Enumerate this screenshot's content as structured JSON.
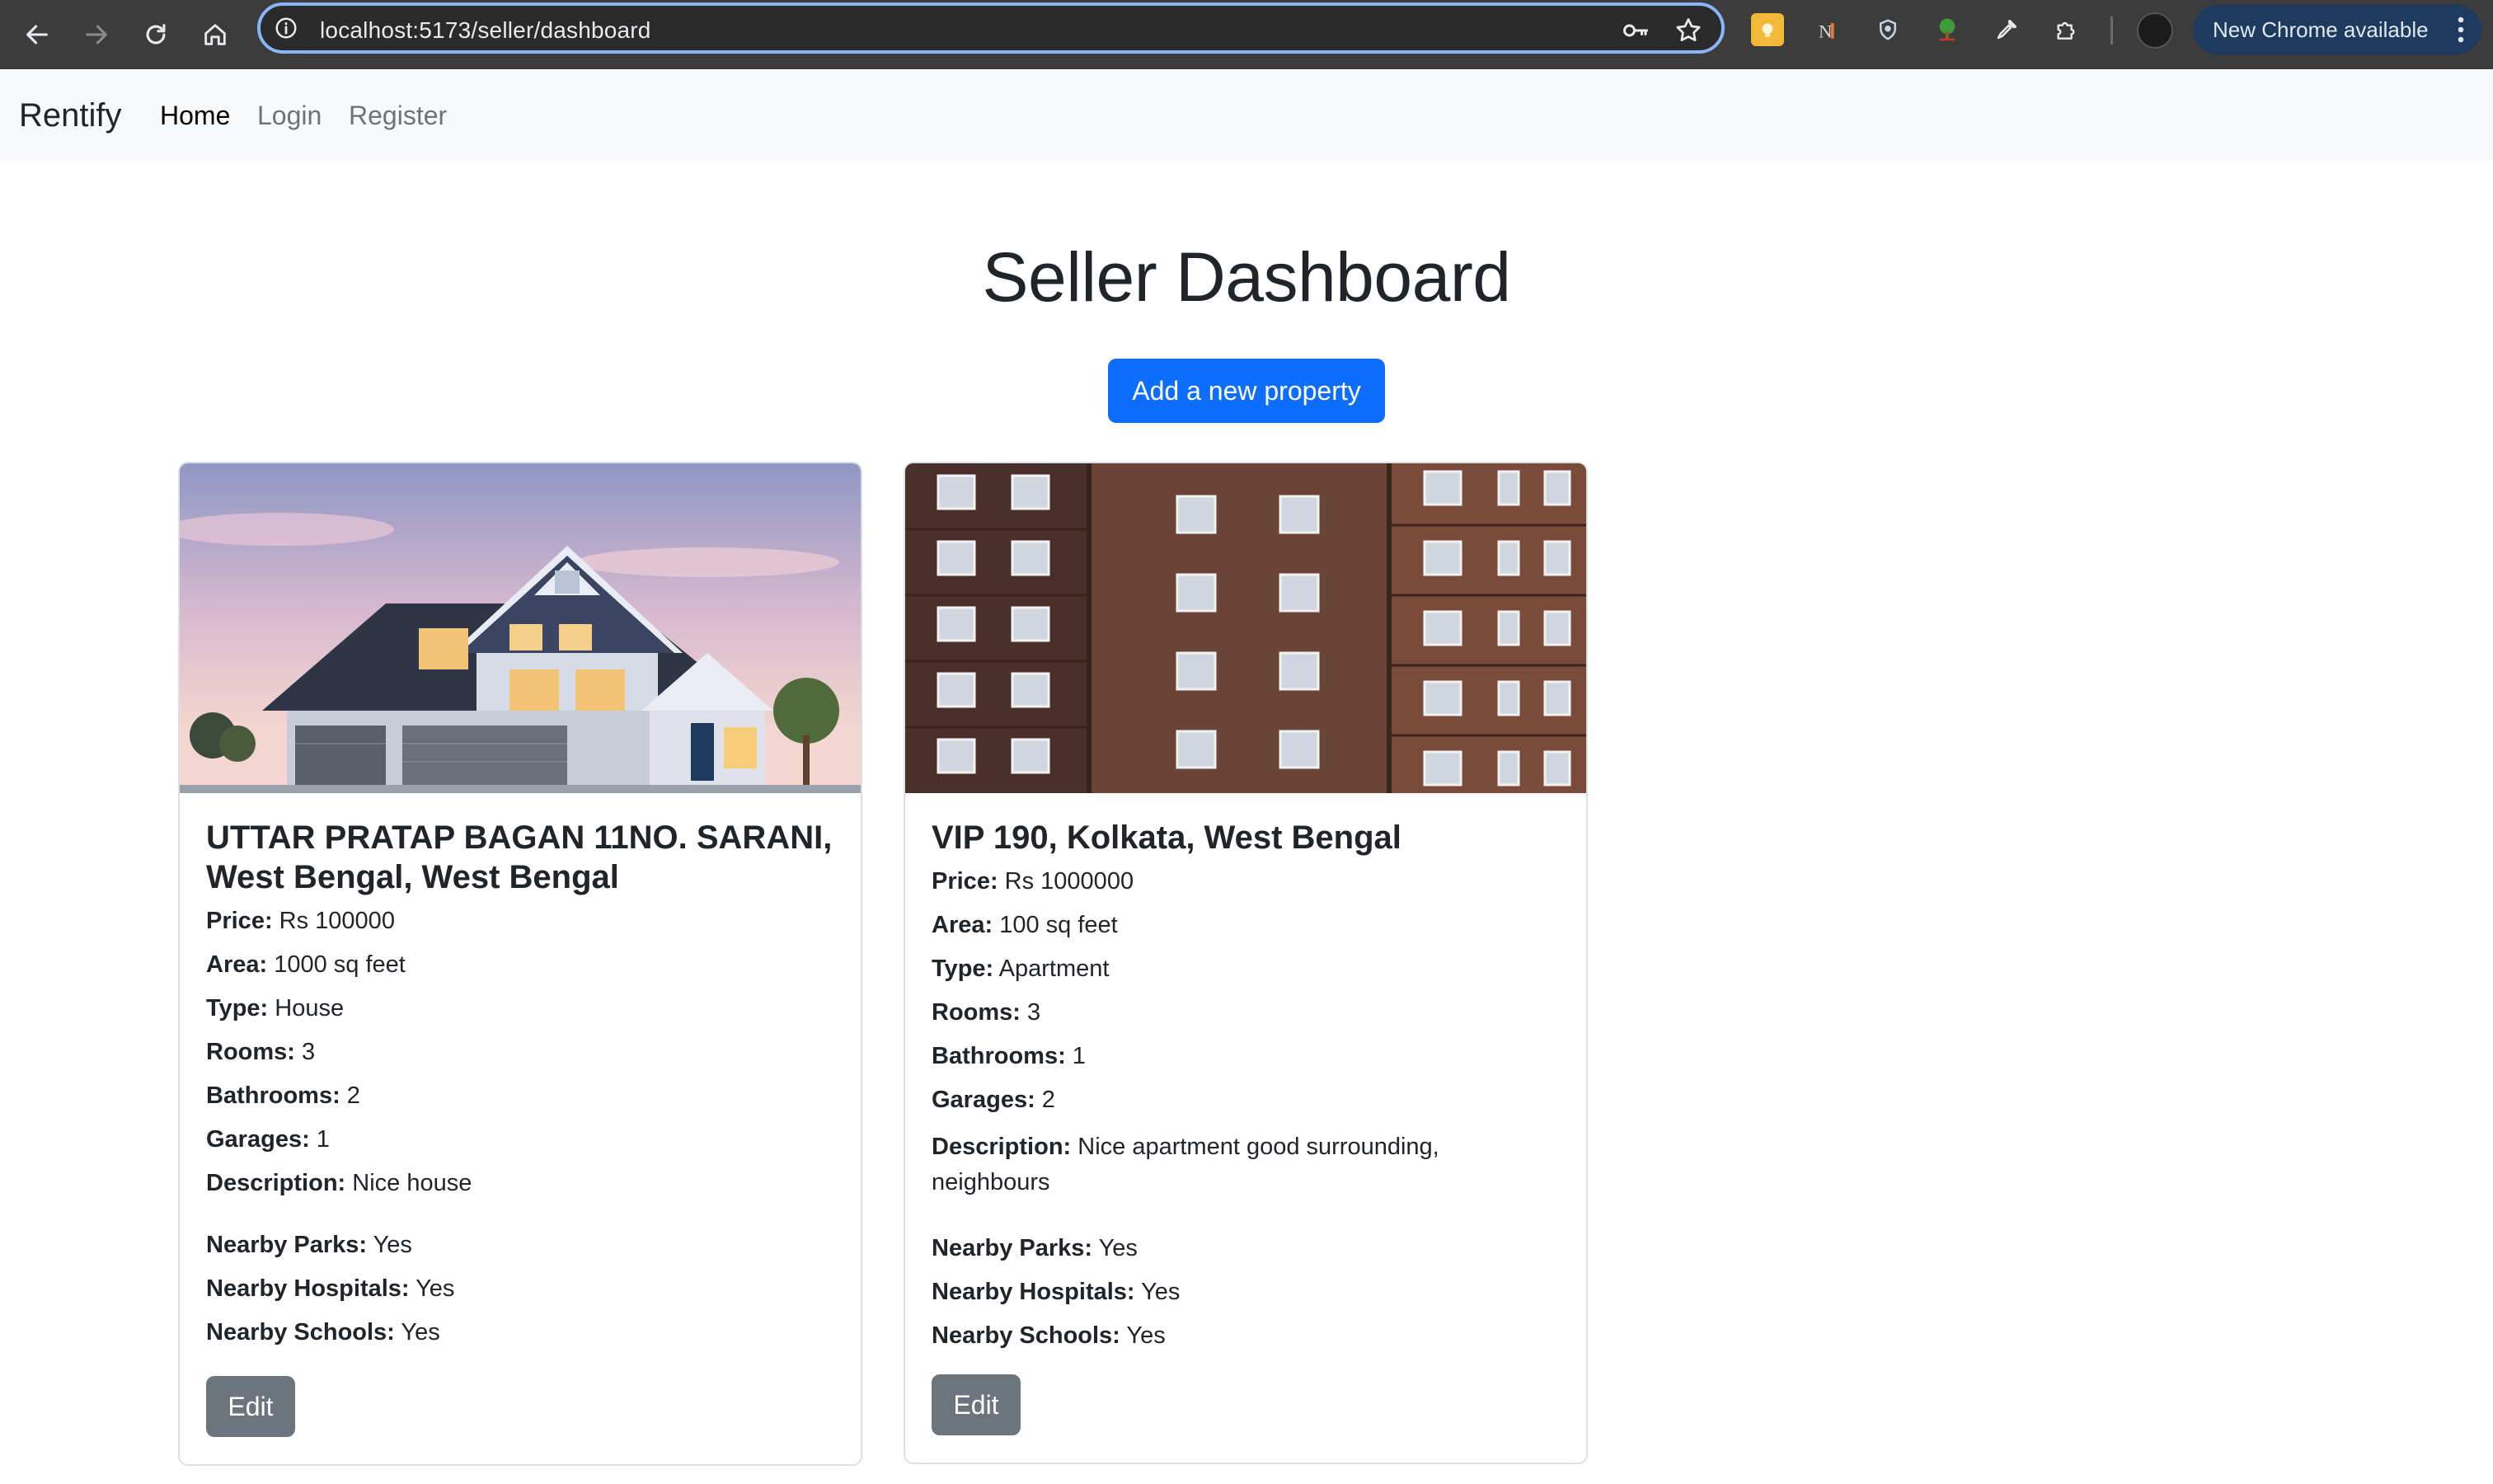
{
  "browser": {
    "url": "localhost:5173/seller/dashboard",
    "update_label": "New Chrome available"
  },
  "navbar": {
    "brand": "Rentify",
    "links": [
      {
        "label": "Home",
        "active": true
      },
      {
        "label": "Login",
        "active": false
      },
      {
        "label": "Register",
        "active": false
      }
    ]
  },
  "page": {
    "title": "Seller Dashboard",
    "add_button": "Add a new property"
  },
  "labels": {
    "price": "Price:",
    "area": "Area:",
    "type": "Type:",
    "rooms": "Rooms:",
    "bathrooms": "Bathrooms:",
    "garages": "Garages:",
    "description": "Description:",
    "nearby_parks": "Nearby Parks:",
    "nearby_hospitals": "Nearby Hospitals:",
    "nearby_schools": "Nearby Schools:",
    "edit": "Edit"
  },
  "properties": [
    {
      "title": "UTTAR PRATAP BAGAN 11NO. SARANI, West Bengal, West Bengal",
      "price": "Rs 100000",
      "area": "1000 sq feet",
      "type": "House",
      "rooms": "3",
      "bathrooms": "2",
      "garages": "1",
      "description": "Nice house",
      "nearby_parks": "Yes",
      "nearby_hospitals": "Yes",
      "nearby_schools": "Yes"
    },
    {
      "title": "VIP 190, Kolkata, West Bengal",
      "price": "Rs 1000000",
      "area": "100 sq feet",
      "type": "Apartment",
      "rooms": "3",
      "bathrooms": "1",
      "garages": "2",
      "description": "Nice apartment good surrounding, neighbours",
      "nearby_parks": "Yes",
      "nearby_hospitals": "Yes",
      "nearby_schools": "Yes"
    }
  ],
  "colors": {
    "primary": "#0d6efd",
    "secondary": "#6c757d",
    "navbar_bg": "#f8f9fa",
    "chrome_bg": "#3c3c3c"
  }
}
